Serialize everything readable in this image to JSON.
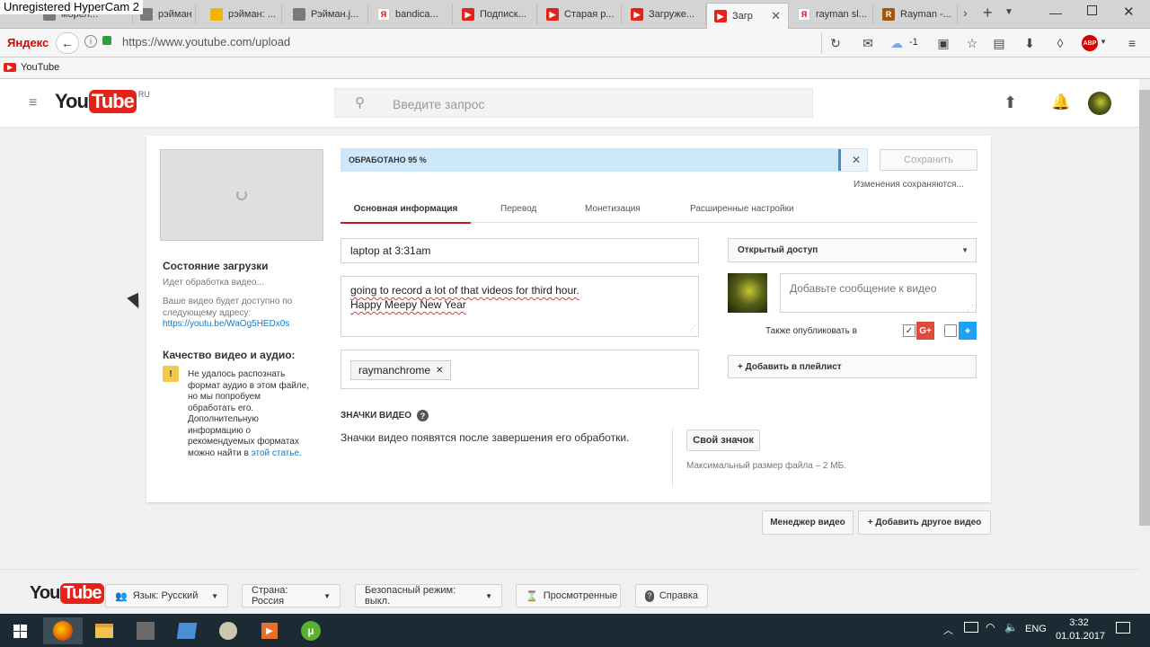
{
  "recorder": {
    "watermark": "Unregistered HyperCam 2"
  },
  "tabs": [
    {
      "label": "морел...",
      "icon": "image-favicon"
    },
    {
      "label": "рэйман ...",
      "icon": "image-favicon"
    },
    {
      "label": "рэйман: ...",
      "icon": "yellow-favicon"
    },
    {
      "label": "Рэйман.j...",
      "icon": "image-favicon"
    },
    {
      "label": "bandica...",
      "icon": "yandex-favicon"
    },
    {
      "label": "Подписк...",
      "icon": "youtube-favicon"
    },
    {
      "label": "Старая р...",
      "icon": "youtube-favicon"
    },
    {
      "label": "Загруже...",
      "icon": "youtube-favicon"
    },
    {
      "label": "Загр",
      "icon": "youtube-favicon"
    },
    {
      "label": "rayman sl...",
      "icon": "yandex-favicon"
    },
    {
      "label": "Rayman -...",
      "icon": "rb-favicon"
    }
  ],
  "browser": {
    "logo": "Яндекс",
    "url": "https://www.youtube.com/upload",
    "cloud_badge": "-1",
    "bookmark": "YouTube"
  },
  "youtube": {
    "logo_you": "You",
    "logo_tube": "Tube",
    "region": "RU",
    "search_placeholder": "Введите запрос"
  },
  "upload": {
    "progress_label": "ОБРАБОТАНО 95 %",
    "progress": 0.95,
    "save_button": "Сохранить",
    "saving_status": "Изменения сохраняются...",
    "status_title": "Состояние загрузки",
    "status_text": "Идет обработка видео...",
    "available_text": "Ваше видео будет доступно по следующему адресу:",
    "video_link": "https://youtu.be/WaOg5HEDx0s",
    "quality_title": "Качество видео и аудио:",
    "warning_text": "Не удалось распознать формат аудио в этом файле, но мы попробуем обработать его. Дополнительную информацию о рекомендуемых форматах можно найти в",
    "warning_link": "этой статье."
  },
  "tabs_upload": [
    {
      "label": "Основная информация"
    },
    {
      "label": "Перевод"
    },
    {
      "label": "Монетизация"
    },
    {
      "label": "Расширенные настройки"
    }
  ],
  "form": {
    "title": "laptop at 3:31am",
    "description_line1": "going to record a lot of that videos for third hour.",
    "description_line2": "Happy Meepy New Year",
    "tag": "raymanchrome",
    "privacy": "Открытый доступ",
    "message_placeholder": "Добавьте сообщение к видео",
    "also_publish": "Также опубликовать в",
    "gplus": "G+",
    "add_playlist": "+ Добавить в плейлист",
    "thumbs_title": "ЗНАЧКИ ВИДЕО",
    "thumbs_text": "Значки видео появятся после завершения его обработки.",
    "custom_thumb": "Свой значок",
    "max_size": "Максимальный размер файла – 2 МБ."
  },
  "actions": {
    "manager": "Менеджер видео",
    "add_another": "+ Добавить другое видео"
  },
  "footer": {
    "language": "Язык: Русский",
    "country": "Страна: Россия",
    "safe_mode": "Безопасный режим: выкл.",
    "history": "Просмотренные",
    "help": "Справка"
  },
  "taskbar": {
    "lang": "ENG",
    "time": "3:32",
    "date": "01.01.2017"
  }
}
